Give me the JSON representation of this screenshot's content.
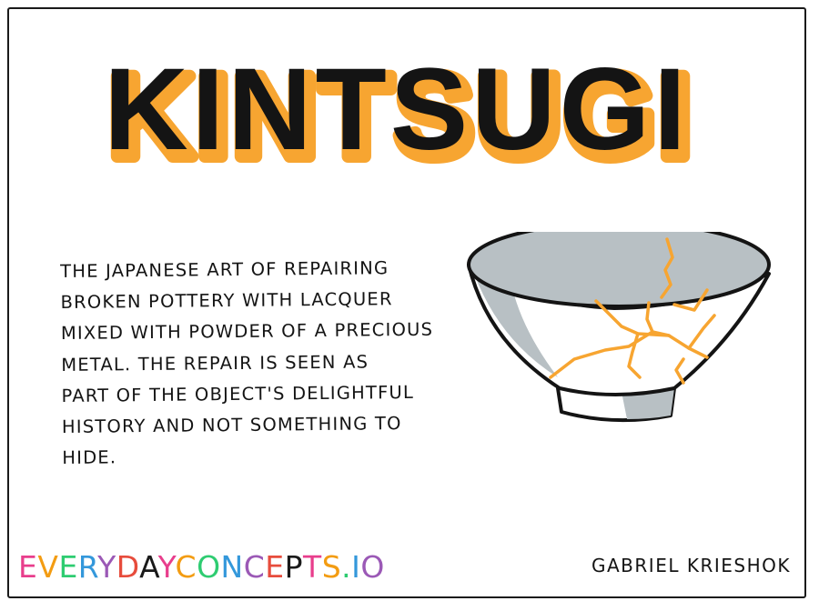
{
  "title": "KINTSUGI",
  "description": {
    "lines": [
      "THE JAPANESE ART OF REPAIRING",
      "BROKEN POTTERY WITH LACQUER",
      "MIXED WITH POWDER OF A PRECIOUS",
      "METAL. THE REPAIR IS SEEN AS",
      "PART OF THE OBJECT'S DELIGHTFUL",
      "HISTORY AND NOT SOMETHING TO",
      "HIDE."
    ]
  },
  "brand": {
    "text": "EVERYDAYCONCEPTS.IO",
    "colors": [
      "#e83e8c",
      "#f39c12",
      "#2ecc71",
      "#3498db",
      "#9b59b6",
      "#e74c3c",
      "#1a1a1a"
    ]
  },
  "author": "Gabriel Krieshok",
  "colors": {
    "gold": "#f7a531",
    "ink": "#141414",
    "bowl_gray": "#b8c0c4"
  },
  "icons": [
    "kintsugi-bowl-illustration"
  ]
}
